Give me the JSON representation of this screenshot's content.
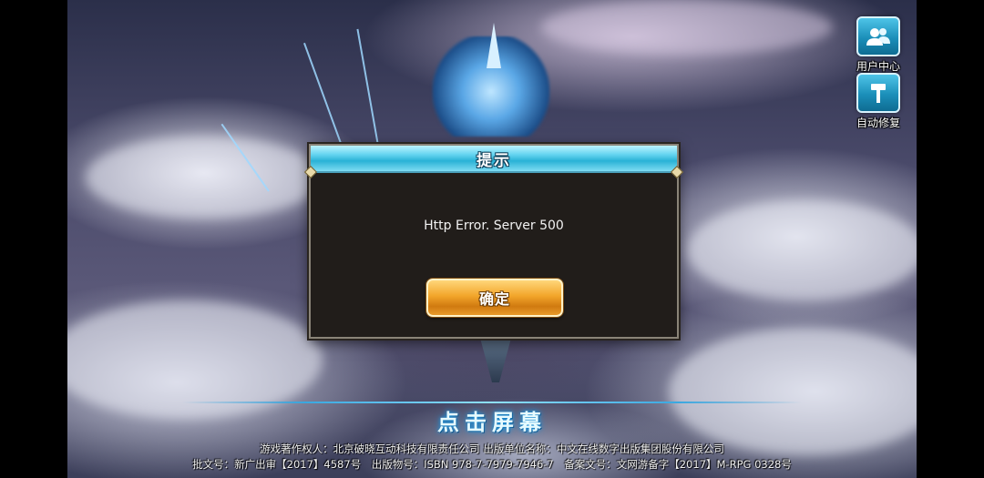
{
  "corner_buttons": {
    "user_center": {
      "label": "用户中心",
      "icon": "users-icon"
    },
    "auto_repair": {
      "label": "自动修复",
      "icon": "hammer-icon"
    }
  },
  "dialog": {
    "title": "提示",
    "message": "Http Error. Server 500",
    "confirm_label": "确定"
  },
  "tap_prompt": "点击屏幕",
  "footer": {
    "line1": "游戏著作权人：北京破晓互动科技有限责任公司 出版单位名称：中文在线数字出版集团股份有限公司",
    "line2": "批文号：新广出审【2017】4587号　出版物号：ISBN 978-7-7979-7946-7　备案文号：文网游备字【2017】M-RPG 0328号"
  },
  "colors": {
    "accent_cyan": "#2ab2d6",
    "button_gold": "#f2a52a",
    "dialog_bg": "#211d1a"
  }
}
